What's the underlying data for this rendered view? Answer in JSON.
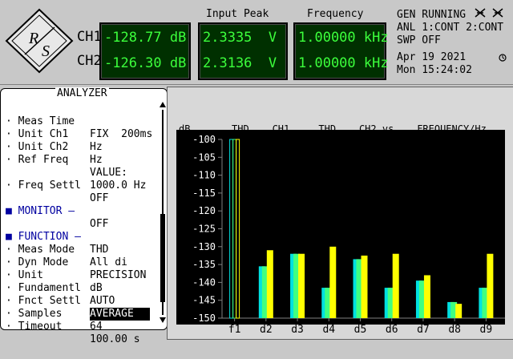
{
  "top": {
    "ch1_label": "CH1",
    "ch2_label": "CH2",
    "ch1_level": "-128.77 dB",
    "ch2_level": "-126.30 dB",
    "input_peak_header": "Input Peak",
    "ch1_peak": "2.3335  V",
    "ch2_peak": "2.3136  V",
    "frequency_header": "Frequency",
    "ch1_freq": "1.00000 kHz",
    "ch2_freq": "1.00000 kHz",
    "status_gen": "GEN RUNNING",
    "status_anl": "ANL 1:CONT 2:CONT",
    "status_swp": "SWP OFF",
    "date": "Apr 19 2021",
    "time": "Mon 15:24:02"
  },
  "menu": {
    "title": "ANALYZER",
    "rows": [
      {
        "label": "· Meas Time",
        "value": "FIX  200ms"
      },
      {
        "label": "· Unit Ch1",
        "value": "Hz"
      },
      {
        "label": "· Unit Ch2",
        "value": "Hz"
      },
      {
        "label": "· Ref Freq",
        "value": "VALUE:"
      },
      {
        "label": "",
        "value": "1000.0 Hz"
      },
      {
        "label": "· Freq Settl",
        "value": "OFF"
      },
      {
        "label": "■ MONITOR —",
        "value": "OFF"
      },
      {
        "label": "■ FUNCTION –",
        "value": "THD"
      },
      {
        "label": "· Meas Mode",
        "value": "All di"
      },
      {
        "label": "· Dyn Mode",
        "value": "PRECISION"
      },
      {
        "label": "· Unit",
        "value": "dB"
      },
      {
        "label": "· Fundamentl",
        "value": "AUTO"
      },
      {
        "label": "· Fnct Settl",
        "value": "AVERAGE"
      },
      {
        "label": "· Samples",
        "value": "64"
      },
      {
        "label": "· Timeout",
        "value": "100.00 s"
      }
    ]
  },
  "chart_data": {
    "type": "bar",
    "title": "THD    CH1,    THD    CH2 vs    FREQUENCY/Hz",
    "ylabel": "dB",
    "ylim": [
      -150,
      -100
    ],
    "yticks": [
      -100,
      -105,
      -110,
      -115,
      -120,
      -125,
      -130,
      -135,
      -140,
      -145,
      -150
    ],
    "categories": [
      "f1",
      "d2",
      "d3",
      "d4",
      "d5",
      "d6",
      "d7",
      "d8",
      "d9"
    ],
    "series": [
      {
        "color": "#00e0e0",
        "values": [
          -100,
          -135.5,
          -132,
          -141.5,
          -133.5,
          -141.5,
          -139.5,
          -145.5,
          -141.5
        ]
      },
      {
        "color": "#40ff80",
        "values": [
          -100,
          -135.5,
          -132,
          -141.5,
          -133.5,
          -141.5,
          -139.5,
          -145.5,
          -141.5
        ]
      },
      {
        "color": "#ffff00",
        "values": [
          -100,
          -131,
          -132,
          -130,
          -132.5,
          -132,
          -138,
          -146,
          -132
        ]
      }
    ],
    "grid": false,
    "colors": {
      "background": "#000000",
      "axis": "#808080",
      "text": "#ffffff"
    }
  }
}
